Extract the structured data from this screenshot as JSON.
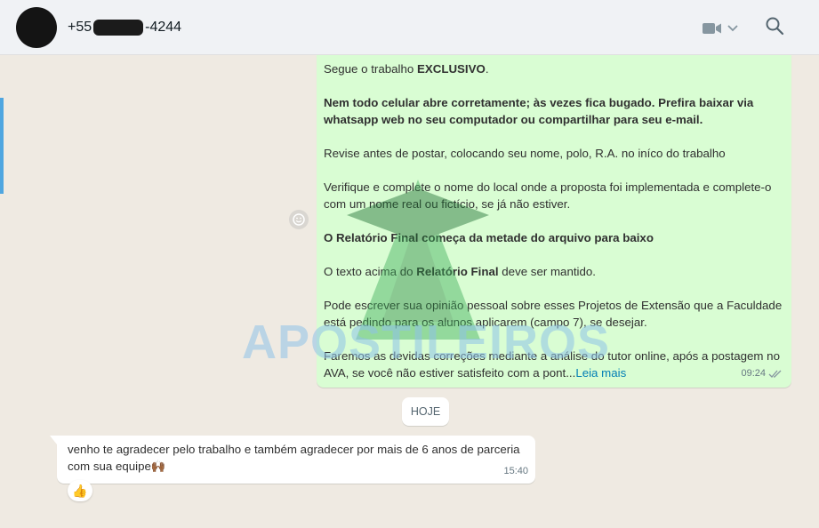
{
  "header": {
    "contact_prefix": "+55",
    "contact_suffix": "-4244",
    "video_icon": "video-camera-icon",
    "chevron_icon": "chevron-down-icon",
    "search_icon": "search-icon"
  },
  "messages": {
    "outgoing": {
      "p1_text": "Segue o trabalho ",
      "p1_bold": "EXCLUSIVO",
      "p1_end": ".",
      "p2_bold": "Nem todo celular abre corretamente; às vezes fica bugado. Prefira baixar via whatsapp web no seu computador ou compartilhar para seu e-mail.",
      "p3": "Revise antes de postar, colocando seu nome, polo, R.A. no iníco do trabalho",
      "p4": "Verifique e complete o nome do local onde a proposta foi implementada e complete-o com um nome real ou fictício, se já não estiver.",
      "p5_bold": "O Relatório Final começa da metade do arquivo para baixo",
      "p6_text": "O texto acima do ",
      "p6_bold": "Relatório Final",
      "p6_end": " deve ser mantido.",
      "p7": "Pode escrever sua opinião pessoal sobre esses Projetos de Extensão que a Faculdade está pedindo para os alunos aplicarem (campo 7), se desejar.",
      "p8": "Faremos as devidas correções mediante a análise do tutor online, após a postagem no AVA, se você não estiver satisfeito com a pont...",
      "read_more": "Leia mais",
      "time": "09:24"
    },
    "date_chip": "HOJE",
    "incoming": {
      "text": "venho te agradecer pelo trabalho e também agradecer por mais de 6 anos de parceria com sua equipe🙌🏾",
      "time": "15:40",
      "reaction": "👍"
    }
  },
  "watermark": "APOSTILEIROS",
  "colors": {
    "outgoing_bubble": "#d9fdd3",
    "incoming_bubble": "#ffffff",
    "chat_bg": "#efeae2",
    "header_bg": "#f0f2f5",
    "link": "#027eb5"
  }
}
